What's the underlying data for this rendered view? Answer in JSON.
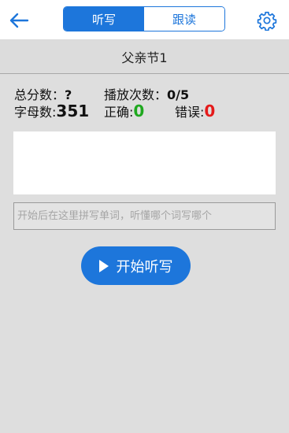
{
  "header": {
    "back_icon": "arrow-left-icon",
    "settings_icon": "gear-icon",
    "accent_color": "#1d76db",
    "tabs": [
      {
        "label": "听写",
        "active": true
      },
      {
        "label": "跟读",
        "active": false
      }
    ]
  },
  "lesson": {
    "title": "父亲节1"
  },
  "stats": {
    "total_score_label": "总分数：",
    "total_score_value": "?",
    "play_count_label": "播放次数：",
    "play_count_value": "0/5",
    "letter_count_label": "字母数:",
    "letter_count_value": "351",
    "correct_label": "正确:",
    "correct_value": "0",
    "wrong_label": "错误:",
    "wrong_value": "0",
    "correct_color": "#1fa81f",
    "wrong_color": "#e41a1a"
  },
  "input": {
    "placeholder": "开始后在这里拼写单词，听懂哪个词写哪个",
    "value": ""
  },
  "start_button": {
    "label": "开始听写",
    "icon": "play-icon"
  }
}
